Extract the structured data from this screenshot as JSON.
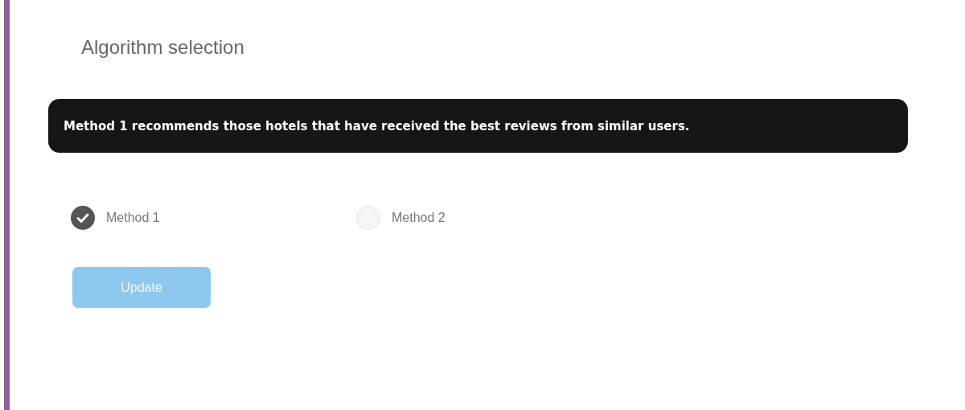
{
  "title": "Algorithm selection",
  "description": "Method 1 recommends those hotels that have received the best reviews from similar users.",
  "options": [
    {
      "label": "Method 1",
      "selected": true
    },
    {
      "label": "Method 2",
      "selected": false
    }
  ],
  "button": {
    "label": "Update",
    "disabled": true
  }
}
